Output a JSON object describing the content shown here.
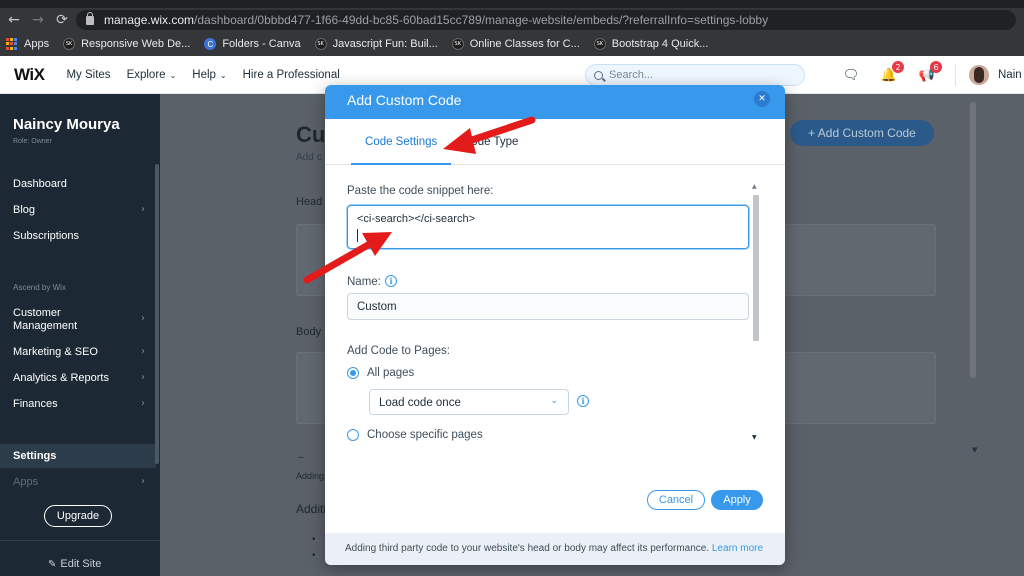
{
  "browser": {
    "url_host": "manage.wix.com",
    "url_path": "/dashboard/0bbbd477-1f66-49dd-bc85-60bad15cc789/manage-website/embeds/?referralInfo=settings-lobby",
    "bookmarks": [
      {
        "label": "Apps",
        "icon": "apps-grid-icon"
      },
      {
        "label": "Responsive Web De...",
        "icon": "sk-icon"
      },
      {
        "label": "Folders - Canva",
        "icon": "canva-icon"
      },
      {
        "label": "Javascript Fun: Buil...",
        "icon": "sk-icon"
      },
      {
        "label": "Online Classes for C...",
        "icon": "sk-icon"
      },
      {
        "label": "Bootstrap 4 Quick...",
        "icon": "sk-icon"
      }
    ]
  },
  "header": {
    "logo": "WiX",
    "nav": [
      "My Sites",
      "Explore",
      "Help",
      "Hire a Professional"
    ],
    "search_placeholder": "Search...",
    "notifications_count": "2",
    "updates_count": "6",
    "user_short": "Nain"
  },
  "sidebar": {
    "user_name": "Naincy Mourya",
    "role": "Role: Owner",
    "items": [
      {
        "label": "Dashboard"
      },
      {
        "label": "Blog"
      },
      {
        "label": "Subscriptions"
      },
      {
        "label": "Customer Management"
      },
      {
        "label": "Marketing & SEO"
      },
      {
        "label": "Analytics & Reports"
      },
      {
        "label": "Finances"
      },
      {
        "label": "Settings"
      },
      {
        "label": "Apps"
      }
    ],
    "section": "Ascend by Wix",
    "upgrade_label": "Upgrade",
    "edit_site_label": "Edit Site"
  },
  "main": {
    "title": "Cu",
    "subtitle": "Add c",
    "head_label": "Head",
    "body_label": "Body",
    "adding": "Adding",
    "additional": "Additi",
    "add_button": "+ Add Custom Code"
  },
  "modal": {
    "title": "Add Custom Code",
    "tabs": [
      "Code Settings",
      "Code Type"
    ],
    "snippet_label": "Paste the code snippet here:",
    "snippet_value": "<ci-search></ci-search>",
    "name_label": "Name:",
    "name_value": "Custom",
    "pages_label": "Add Code to Pages:",
    "radio_all": "All pages",
    "load_option": "Load code once",
    "radio_specific": "Choose specific pages",
    "cancel_label": "Cancel",
    "apply_label": "Apply",
    "footer_text": "Adding third party code to your website's head or body may affect its performance.",
    "footer_link": "Learn more"
  },
  "colors": {
    "wix_blue": "#3899ec",
    "sidebar_bg": "#1c2833",
    "annotation_red": "#e31b1b",
    "badge_red": "#e63a48"
  }
}
